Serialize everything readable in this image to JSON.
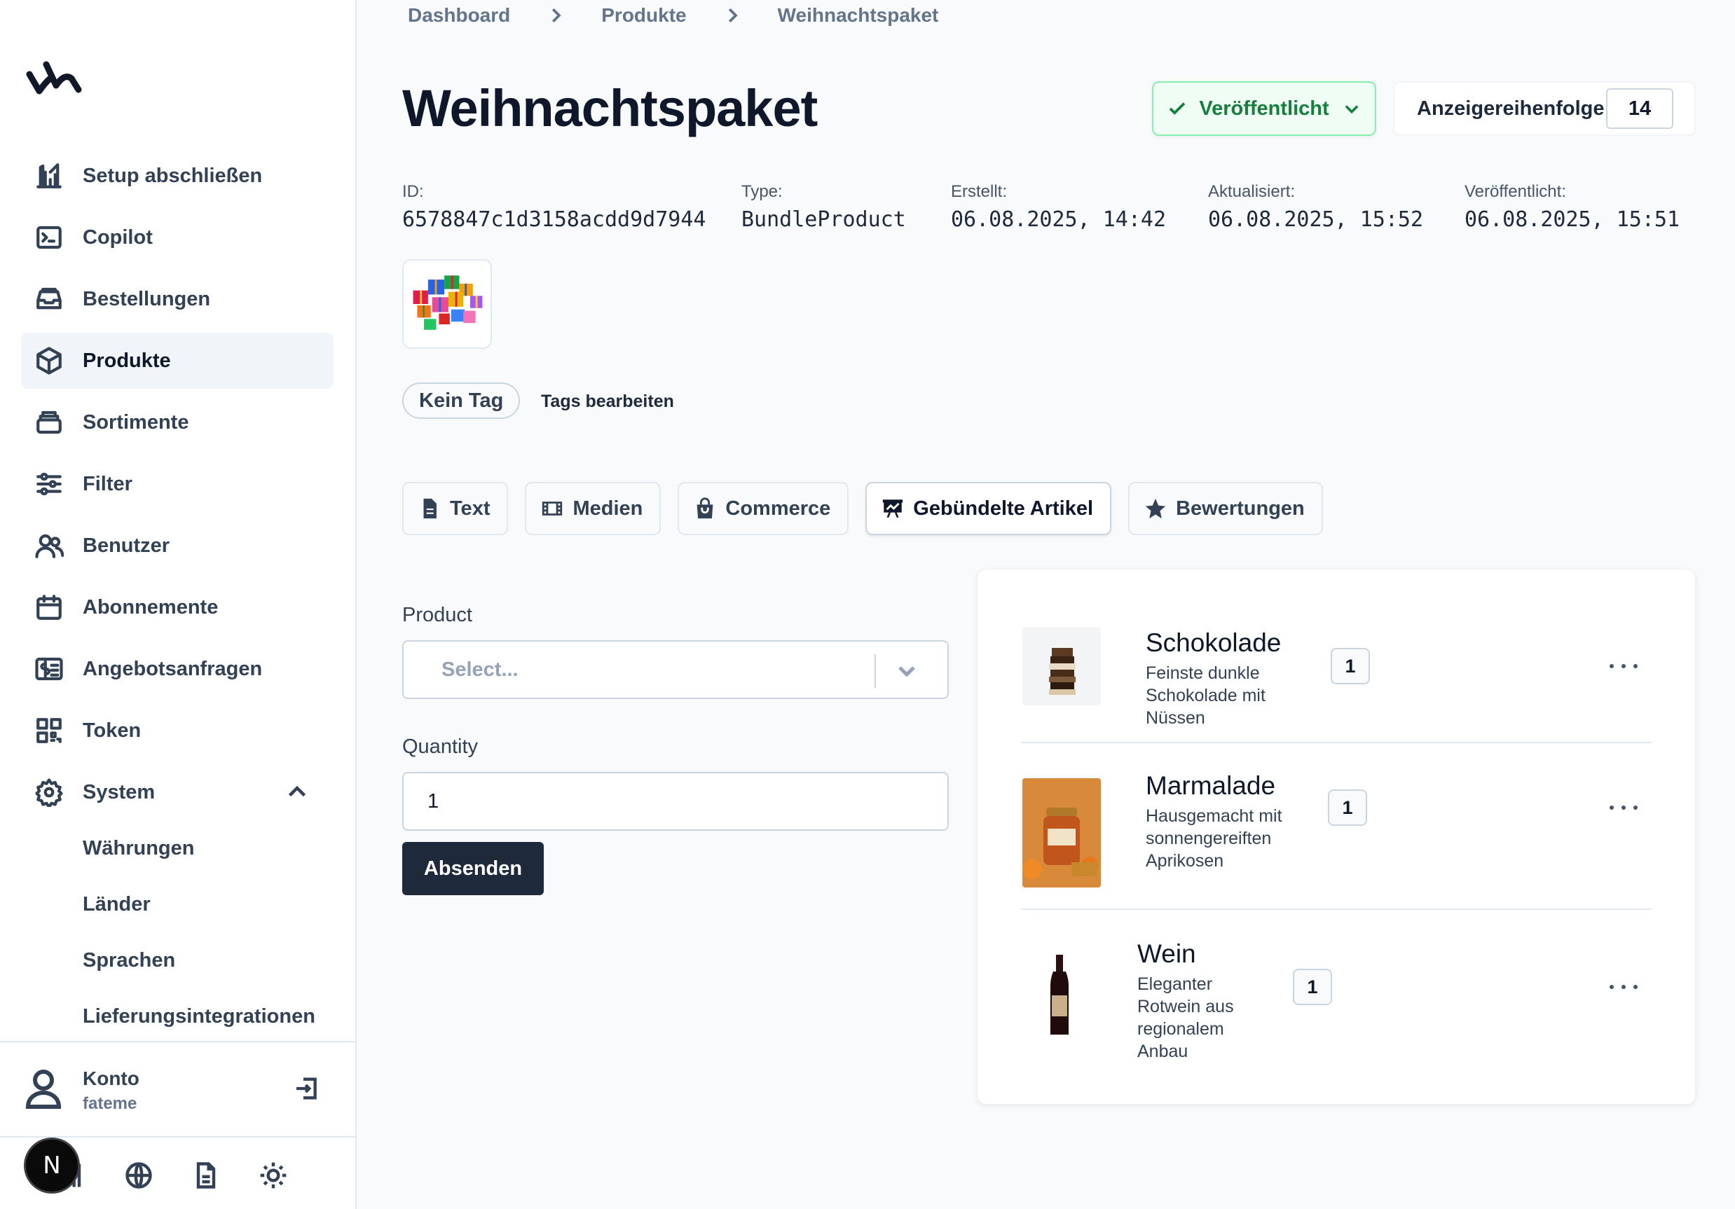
{
  "breadcrumb": [
    "Dashboard",
    "Produkte",
    "Weihnachtspaket"
  ],
  "page": {
    "title": "Weihnachtspaket",
    "status": "Veröffentlicht",
    "order_label": "Anzeigereihenfolge",
    "order_value": "14"
  },
  "meta": [
    {
      "label": "ID:",
      "value": "6578847c1d3158acdd9d7944"
    },
    {
      "label": "Type:",
      "value": "BundleProduct"
    },
    {
      "label": "Erstellt:",
      "value": "06.08.2025, 14:42"
    },
    {
      "label": "Aktualisiert:",
      "value": "06.08.2025, 15:52"
    },
    {
      "label": "Veröffentlicht:",
      "value": "06.08.2025, 15:51"
    }
  ],
  "tags": {
    "pill": "Kein Tag",
    "edit": "Tags bearbeiten"
  },
  "tabs": [
    {
      "label": "Text",
      "icon": "document-icon"
    },
    {
      "label": "Medien",
      "icon": "film-icon"
    },
    {
      "label": "Commerce",
      "icon": "shopping-bag-icon"
    },
    {
      "label": "Gebündelte Artikel",
      "icon": "presentation-chart-icon",
      "active": true
    },
    {
      "label": "Bewertungen",
      "icon": "star-icon"
    }
  ],
  "form": {
    "product_label": "Product",
    "product_placeholder": "Select...",
    "quantity_label": "Quantity",
    "quantity_value": "1",
    "submit": "Absenden"
  },
  "bundle_items": [
    {
      "title": "Schokolade",
      "desc": [
        "Feinste dunkle",
        "Schokolade mit",
        "Nüssen"
      ],
      "qty": "1",
      "image": "chocolate-stack"
    },
    {
      "title": "Marmalade",
      "desc": [
        "Hausgemacht mit",
        "sonnengereiften",
        "Aprikosen"
      ],
      "qty": "1",
      "image": "apricot-jam-jar"
    },
    {
      "title": "Wein",
      "desc": [
        "Eleganter",
        "Rotwein aus",
        "regionalem",
        "Anbau"
      ],
      "qty": "1",
      "image": "red-wine-bottle"
    }
  ],
  "sidebar": {
    "items": [
      {
        "label": "Setup abschließen",
        "icon": "building-chart-icon"
      },
      {
        "label": "Copilot",
        "icon": "terminal-icon"
      },
      {
        "label": "Bestellungen",
        "icon": "inbox-stack-icon"
      },
      {
        "label": "Produkte",
        "icon": "cube-icon",
        "active": true
      },
      {
        "label": "Sortimente",
        "icon": "stack-icon"
      },
      {
        "label": "Filter",
        "icon": "sliders-icon"
      },
      {
        "label": "Benutzer",
        "icon": "users-icon"
      },
      {
        "label": "Abonnemente",
        "icon": "calendar-icon"
      },
      {
        "label": "Angebotsanfragen",
        "icon": "receipt-dollar-icon"
      },
      {
        "label": "Token",
        "icon": "qr-code-icon"
      },
      {
        "label": "System",
        "icon": "gear-icon",
        "expanded": true
      }
    ],
    "subitems": [
      "Währungen",
      "Länder",
      "Sprachen",
      "Lieferungsintegrationen"
    ],
    "account": {
      "label": "Konto",
      "user": "fateme"
    },
    "footer_icons": [
      "library-icon",
      "globe-icon",
      "document-icon",
      "sun-icon"
    ],
    "badge": "N"
  },
  "colors": {
    "accent": "#1e293b",
    "published_green": "#15803d",
    "published_bg": "#f0fdf4"
  }
}
